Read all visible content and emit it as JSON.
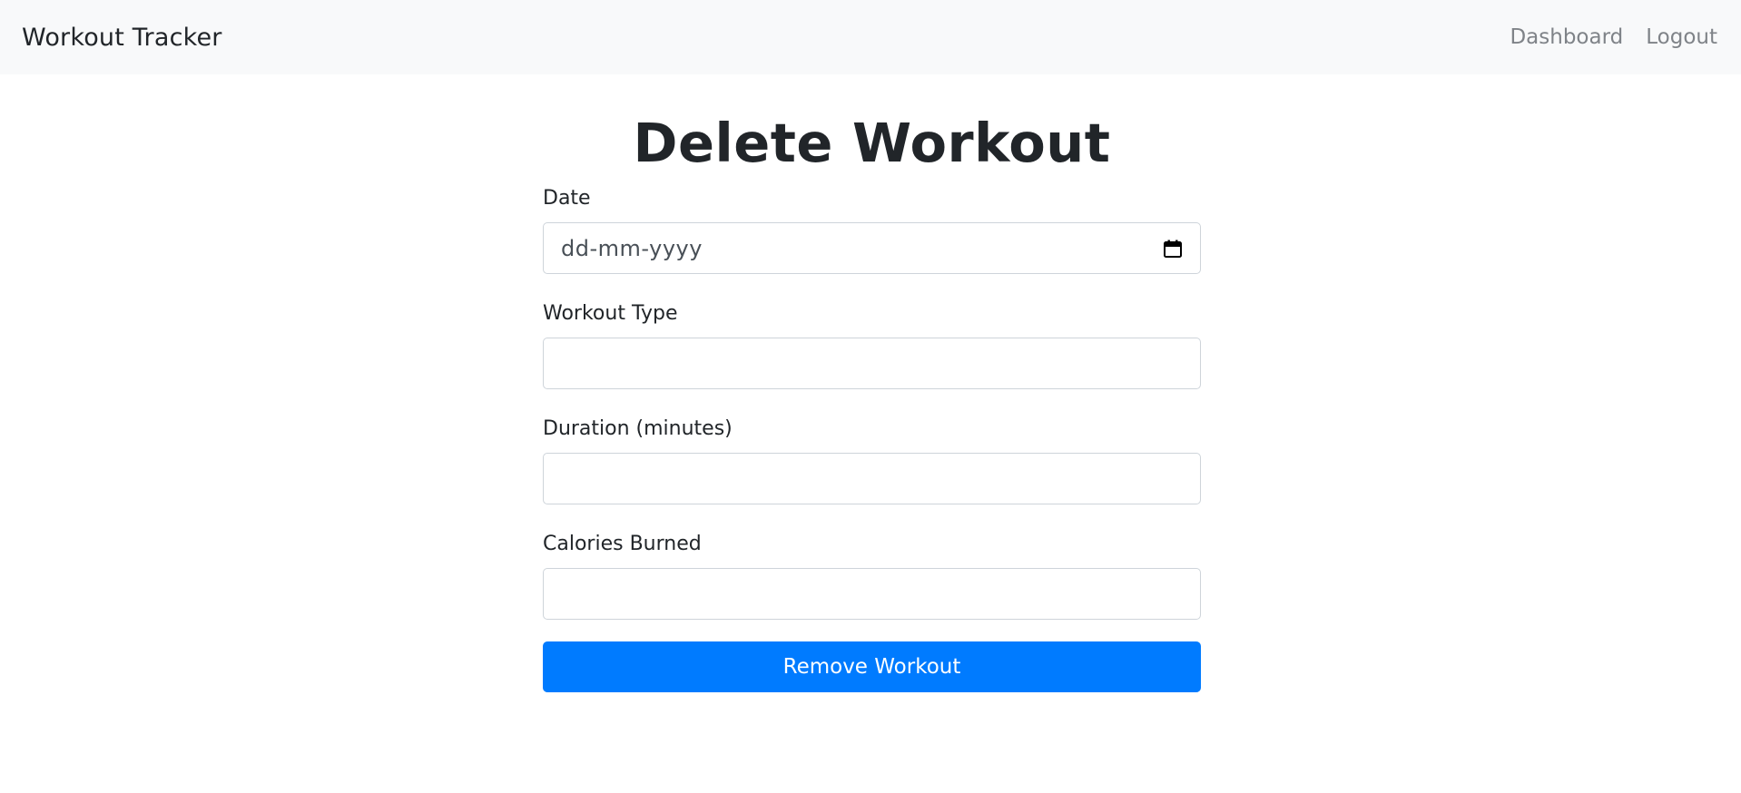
{
  "navbar": {
    "brand": "Workout Tracker",
    "links": [
      {
        "label": "Dashboard"
      },
      {
        "label": "Logout"
      }
    ]
  },
  "page": {
    "title": "Delete Workout"
  },
  "form": {
    "date": {
      "label": "Date",
      "placeholder": "dd-mm-yyyy",
      "value": ""
    },
    "workout_type": {
      "label": "Workout Type",
      "value": ""
    },
    "duration": {
      "label": "Duration (minutes)",
      "value": ""
    },
    "calories": {
      "label": "Calories Burned",
      "value": ""
    },
    "submit_label": "Remove Workout"
  },
  "icons": {
    "calendar": "calendar-icon"
  },
  "colors": {
    "navbar_bg": "#f8f9fa",
    "nav_link": "#7f8388",
    "primary": "#007bff",
    "input_border": "#ced4da",
    "text": "#212529"
  }
}
